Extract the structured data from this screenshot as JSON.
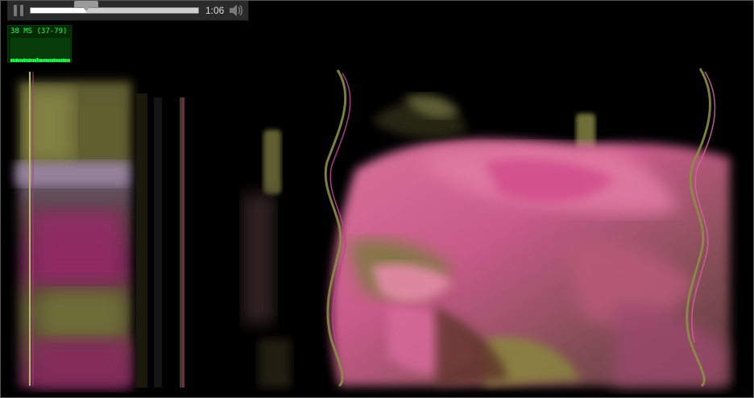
{
  "player": {
    "time_label": "1:06",
    "progress_fraction": 0.33,
    "state": "playing",
    "pause_icon": "pause-icon",
    "volume_icon": "speaker-icon"
  },
  "stats": {
    "label": "38 MS (37-79)",
    "graph_values": [
      40,
      42,
      38,
      44,
      39,
      41,
      38,
      45,
      40,
      38,
      43,
      39,
      41,
      38,
      52,
      39,
      40,
      38,
      42,
      39,
      37,
      41,
      38,
      44,
      40,
      39,
      38,
      41,
      43,
      39,
      38,
      40
    ],
    "colors": {
      "text": "#26ff55",
      "bar": "#26ff55",
      "background": "#002b00"
    }
  },
  "colors": {
    "control_bar": "#2a2a2a",
    "progress_track": "#cfcfcf",
    "progress_fill": "#ffffff",
    "video_pink": "#d65a8c",
    "video_olive": "#8a8a3c"
  }
}
